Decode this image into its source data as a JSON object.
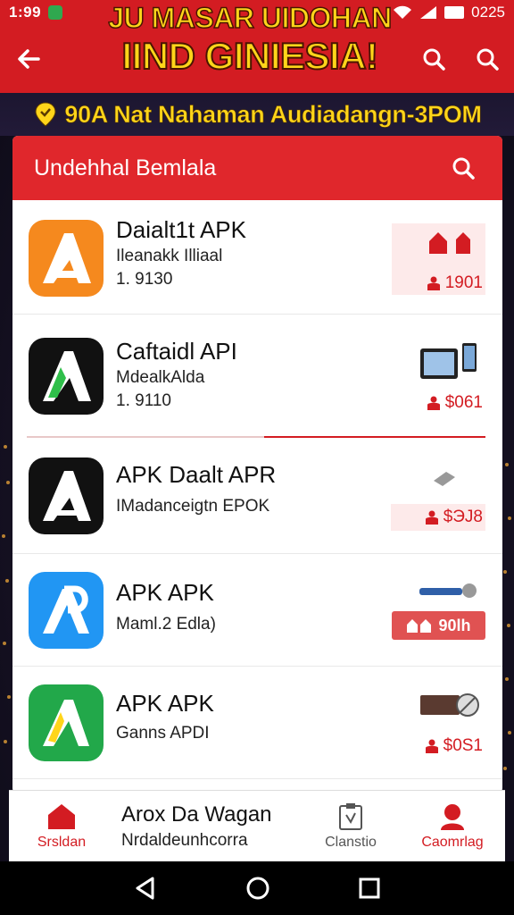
{
  "status_bar": {
    "time": "1:99",
    "battery_text": "0225"
  },
  "header": {
    "title_line1": "JU MASAR UIDOHAN",
    "title_line2": "IIND GINIESIA!"
  },
  "tagline": "90A Nat Nahaman Audiadangn-3POM",
  "card": {
    "title": "Undehhal Bemlala"
  },
  "apps": [
    {
      "name": "Daialt1t APK",
      "subtitle": "Ileanakk Illiaal",
      "meta": "1. 9130",
      "price": "1901",
      "icon_color": "#f5891e"
    },
    {
      "name": "Caftaidl API",
      "subtitle": "MdealkAlda",
      "meta": "1. 9110",
      "price": "$061",
      "icon_color": "#111111"
    },
    {
      "name": "APK Daalt APR",
      "subtitle": "IMadanceigtn EPOK",
      "meta": "",
      "price": "$ЭJ8",
      "icon_color": "#111111"
    },
    {
      "name": "APK APK",
      "subtitle": "Maml.2 Edla)",
      "meta": "",
      "price": "90lh",
      "icon_color": "#2196f3"
    },
    {
      "name": "APK APK",
      "subtitle": "Ganns APDI",
      "meta": "",
      "price": "$0S1",
      "icon_color": "#22a84a"
    }
  ],
  "bottom_nav": {
    "home": "Srsldan",
    "center_title": "Arox Da Wagan",
    "center_sub": "Nrdaldeunhcorra",
    "clan": "Clanstio",
    "camp": "Caomrlag"
  },
  "colors": {
    "primary": "#d31c22",
    "accent": "#ffd51a"
  }
}
